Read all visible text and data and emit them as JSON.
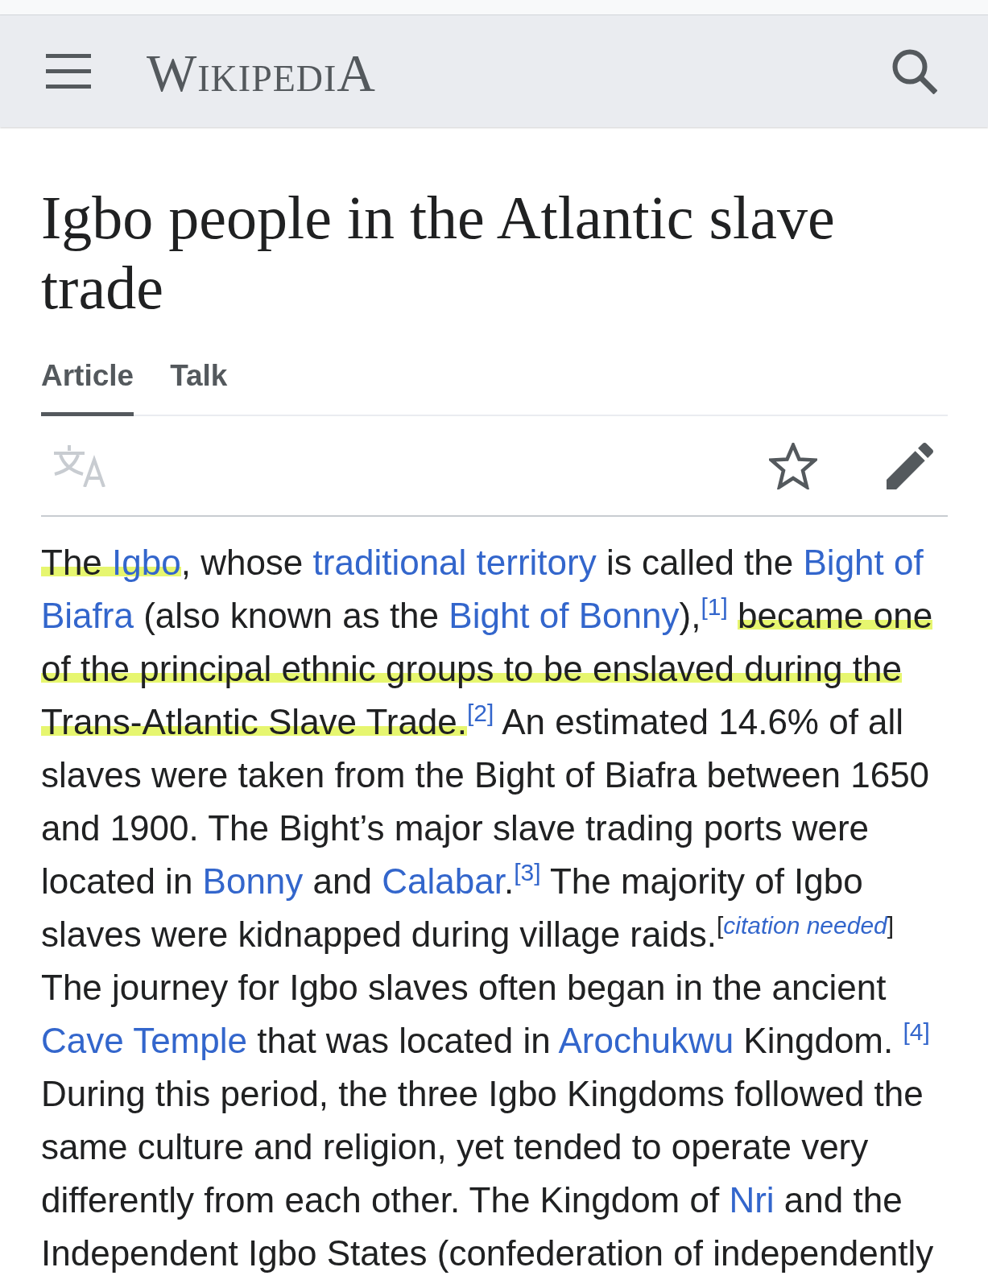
{
  "header": {
    "logo": "WikipediA"
  },
  "page": {
    "title": "Igbo people in the Atlantic slave trade"
  },
  "tabs": [
    {
      "label": "Article",
      "selected": true
    },
    {
      "label": "Talk",
      "selected": false
    }
  ],
  "actions": [
    {
      "kind": "language",
      "disabled": true
    },
    {
      "kind": "watch",
      "disabled": false
    },
    {
      "kind": "edit",
      "disabled": false
    }
  ],
  "paragraph": {
    "segments": [
      {
        "kind": "text",
        "text": "The ",
        "highlighted": true
      },
      {
        "kind": "link",
        "text": "Igbo",
        "highlighted": true
      },
      {
        "kind": "text",
        "text": ", whose ",
        "highlighted": false
      },
      {
        "kind": "link",
        "text": "traditional territory",
        "highlighted": false
      },
      {
        "kind": "text",
        "text": " is called the ",
        "highlighted": false
      },
      {
        "kind": "link",
        "text": "Bight of",
        "highlighted": false,
        "space_after": true
      },
      {
        "kind": "link",
        "text": "Biafra",
        "highlighted": false
      },
      {
        "kind": "text",
        "text": " (also known as the ",
        "highlighted": false
      },
      {
        "kind": "link",
        "text": "Bight of Bonny",
        "highlighted": false
      },
      {
        "kind": "text",
        "text": "),",
        "highlighted": false
      },
      {
        "kind": "ref",
        "text": "[1]",
        "highlighted": false,
        "space_after": true
      },
      {
        "kind": "text",
        "text": "became one",
        "highlighted": true,
        "space_after": true
      },
      {
        "kind": "text",
        "text": "of the principal ethnic groups to be enslaved during the",
        "highlighted": true,
        "space_after": true
      },
      {
        "kind": "text",
        "text": "Trans-Atlantic Slave Trade.",
        "highlighted": true
      },
      {
        "kind": "ref",
        "text": "[2]",
        "highlighted": false
      },
      {
        "kind": "text",
        "text": " An estimated 14.6% of all slaves were taken from the Bight of Biafra between 1650 and 1900. The Bight’s major slave trading ports were located in ",
        "highlighted": false
      },
      {
        "kind": "link",
        "text": "Bonny",
        "highlighted": false
      },
      {
        "kind": "text",
        "text": " and ",
        "highlighted": false
      },
      {
        "kind": "link",
        "text": "Calabar",
        "highlighted": false
      },
      {
        "kind": "text",
        "text": ".",
        "highlighted": false
      },
      {
        "kind": "ref",
        "text": "[3]",
        "highlighted": false
      },
      {
        "kind": "text",
        "text": " The majority of Igbo slaves were kidnapped during village raids.",
        "highlighted": false
      },
      {
        "kind": "note",
        "open": "[",
        "text": "citation needed",
        "close": "]",
        "highlighted": false
      },
      {
        "kind": "text",
        "text": " The journey for Igbo slaves often began in the ancient ",
        "highlighted": false
      },
      {
        "kind": "link",
        "text": "Cave Temple",
        "highlighted": false
      },
      {
        "kind": "text",
        "text": " that was located in ",
        "highlighted": false
      },
      {
        "kind": "link",
        "text": "Arochukwu",
        "highlighted": false
      },
      {
        "kind": "text",
        "text": " Kingdom. ",
        "highlighted": false
      },
      {
        "kind": "ref",
        "text": "[4]",
        "highlighted": false
      },
      {
        "kind": "text",
        "text": " During this period, the three Igbo Kingdoms followed the same culture and religion, yet tended to operate very differently from each other. The Kingdom of ",
        "highlighted": false
      },
      {
        "kind": "link",
        "text": "Nri",
        "highlighted": false
      },
      {
        "kind": "text",
        "text": " and the Independent Igbo States (confederation of independently",
        "highlighted": false
      }
    ]
  }
}
